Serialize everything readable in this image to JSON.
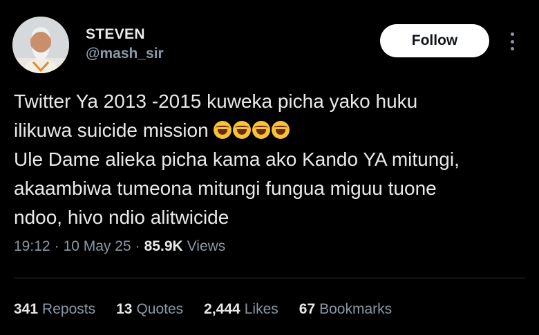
{
  "user": {
    "display_name": "STEVEN",
    "handle": "@mash_sir"
  },
  "follow_label": "Follow",
  "tweet": {
    "text_line1": "Twitter Ya 2013 -2015  kuweka picha yako huku",
    "text_line2": "ilikuwa suicide mission",
    "text_line3": "Ule Dame alieka picha kama ako Kando YA mitungi,",
    "text_line4": "akaambiwa tumeona mitungi fungua miguu tuone",
    "text_line5": "ndoo, hivo ndio alitwicide",
    "emoji": "rolling-on-the-floor-laughing",
    "emoji_count": 4
  },
  "meta": {
    "time": "19:12",
    "date": "10 May 25",
    "views_count": "85.9K",
    "views_label": "Views"
  },
  "stats": {
    "reposts_count": "341",
    "reposts_label": "Reposts",
    "quotes_count": "13",
    "quotes_label": "Quotes",
    "likes_count": "2,444",
    "likes_label": "Likes",
    "bookmarks_count": "67",
    "bookmarks_label": "Bookmarks"
  },
  "colors": {
    "background": "#000000",
    "primary_text": "#e7e9ea",
    "secondary_text": "#8b98a5",
    "follow_button_bg": "#ffffff",
    "divider": "#2f3336"
  }
}
